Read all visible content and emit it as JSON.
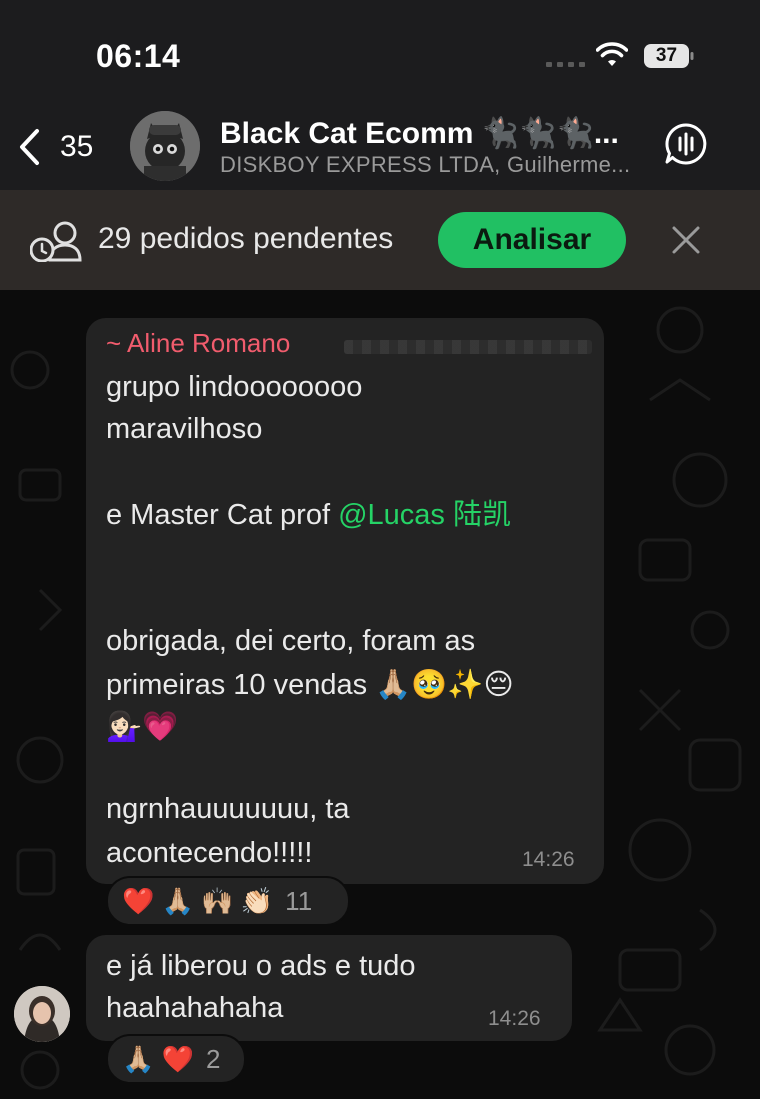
{
  "status_bar": {
    "time": "06:14",
    "battery": "37"
  },
  "header": {
    "back_count": "35",
    "title": "Black Cat Ecomm 🐈‍⬛🐈‍⬛🐈‍⬛...",
    "subtitle": "DISKBOY EXPRESS LTDA, Guilherme..."
  },
  "banner": {
    "text": "29 pedidos pendentes",
    "button_label": "Analisar"
  },
  "messages": [
    {
      "sender": "~ Aline Romano",
      "lines": [
        "grupo lindoooooooo",
        "maravilhoso",
        "",
        "e Master Cat prof ",
        "",
        "",
        "obrigada, dei certo, foram as",
        "primeiras 10 vendas 🙏🏼🥹✨😔",
        "💁🏻‍♀️💗",
        "",
        "ngrnhauuuuuuu, ta",
        "acontecendo!!!!!"
      ],
      "mention": "@Lucas 陆凯",
      "time": "14:26",
      "reactions": "❤️ 🙏🏼 🙌🏼 👏🏻",
      "reaction_count": "11"
    },
    {
      "lines": [
        "e já liberou o ads e tudo",
        "haahahahaha"
      ],
      "time": "14:26",
      "reactions": "🙏🏼 ❤️",
      "reaction_count": "2"
    }
  ],
  "colors": {
    "accent_green": "#21c063",
    "sender_name": "#f15c6d",
    "mention": "#25d366",
    "bubble": "#232323"
  },
  "icons": [
    "back-chevron-icon",
    "voice-chat-icon",
    "pending-orders-icon",
    "close-icon",
    "wifi-icon",
    "battery-icon",
    "signal-icon"
  ]
}
